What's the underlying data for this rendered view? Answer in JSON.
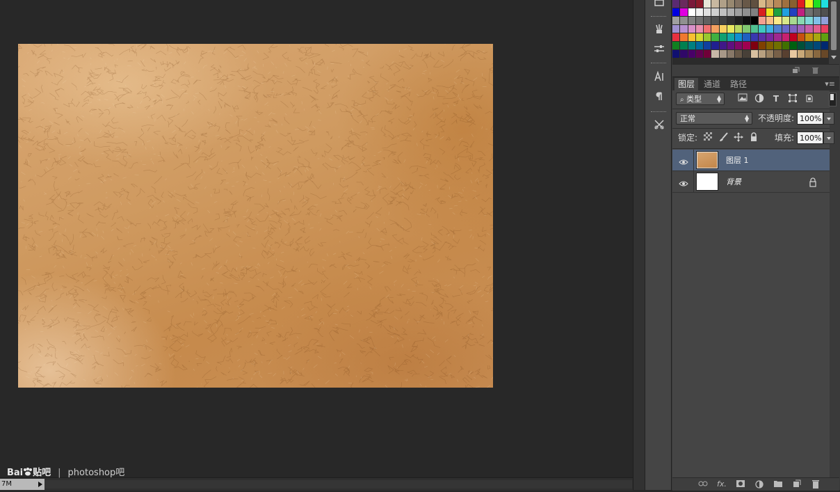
{
  "colors": {
    "workspace": "#282828",
    "panel": "#454545",
    "active_layer": "#51627b"
  },
  "watermark": {
    "brand": "Bai",
    "brand2": "贴吧",
    "separator": "|",
    "forum": "photoshop吧"
  },
  "status": {
    "doc_size": "7M"
  },
  "dock": {
    "icons": [
      "brush-presets-icon",
      "adjustments-icon",
      "character-icon",
      "paragraph-icon",
      "tool-presets-icon"
    ]
  },
  "swatches": {
    "rows": [
      [
        "#5a2a72",
        "#6a2a5e",
        "#7a1a3a",
        "#8a1a2a",
        "#e8e8d8",
        "#c8b8a0",
        "#b0a088",
        "#988870",
        "#807060",
        "#685848",
        "#605040",
        "#d8b888",
        "#c8a070",
        "#b88858",
        "#a07040",
        "#886030",
        "#e02020",
        "#f0f020",
        "#20e020",
        "#20e0e0"
      ],
      [
        "#0000e0",
        "#e000e0",
        "#ffffff",
        "#f0f0f0",
        "#e0e0e0",
        "#d0d0d0",
        "#c0c0c0",
        "#b0b0b0",
        "#a0a0a0",
        "#909090",
        "#808080",
        "#d82020",
        "#f0e020",
        "#20a040",
        "#20a0e0",
        "#2040c0",
        "#c02080",
        "#707070",
        "#606060",
        "#505050"
      ],
      [
        "#a0a0a0",
        "#909090",
        "#808080",
        "#707070",
        "#606060",
        "#505050",
        "#404040",
        "#303030",
        "#202020",
        "#101010",
        "#000000",
        "#f4a090",
        "#f8c088",
        "#fce888",
        "#d8e888",
        "#a8d890",
        "#88d8b0",
        "#80d8d8",
        "#80c0e8",
        "#90a0d8"
      ],
      [
        "#a090d0",
        "#b890d0",
        "#d890c8",
        "#e890b0",
        "#f07070",
        "#f4a060",
        "#f8d060",
        "#e8e860",
        "#b8d860",
        "#80c870",
        "#50c090",
        "#40c8c0",
        "#40b0e0",
        "#5080d0",
        "#6868c8",
        "#8060c0",
        "#a060b8",
        "#c860a8",
        "#e06090",
        "#e84060"
      ],
      [
        "#e83040",
        "#f07830",
        "#f8c030",
        "#d8d830",
        "#98c830",
        "#40b040",
        "#10a070",
        "#10a8a8",
        "#1090d0",
        "#2060c0",
        "#3838b0",
        "#5830a8",
        "#7828a0",
        "#a02890",
        "#c82070",
        "#c00020",
        "#c85010",
        "#c89010",
        "#a8a810",
        "#60a010"
      ],
      [
        "#108020",
        "#008050",
        "#008080",
        "#0068a0",
        "#1040a0",
        "#202090",
        "#401888",
        "#601080",
        "#800868",
        "#a00050",
        "#800010",
        "#804000",
        "#806000",
        "#707000",
        "#407000",
        "#006010",
        "#005038",
        "#005060",
        "#004878",
        "#002870"
      ],
      [
        "#101070",
        "#300868",
        "#480068",
        "#600050",
        "#700038",
        "#c8b8a8",
        "#a89888",
        "#887868",
        "#685848",
        "#484038",
        "#d8c0a0",
        "#b8a080",
        "#988060",
        "#786048",
        "#584030",
        "#e8c8a0",
        "#c8a878",
        "#a88858",
        "#886840",
        "#684828"
      ]
    ]
  },
  "tabs": {
    "layers": "图层",
    "channels": "通道",
    "paths": "路径"
  },
  "filter": {
    "kind": "类型"
  },
  "blend": {
    "mode": "正常",
    "opacity_label": "不透明度:",
    "opacity": "100%"
  },
  "lock": {
    "label": "锁定:",
    "fill_label": "填充:",
    "fill": "100%"
  },
  "layers": [
    {
      "name": "图层 1",
      "visible": true,
      "selected": true,
      "locked": false
    },
    {
      "name": "背景",
      "visible": true,
      "selected": false,
      "locked": true
    }
  ]
}
